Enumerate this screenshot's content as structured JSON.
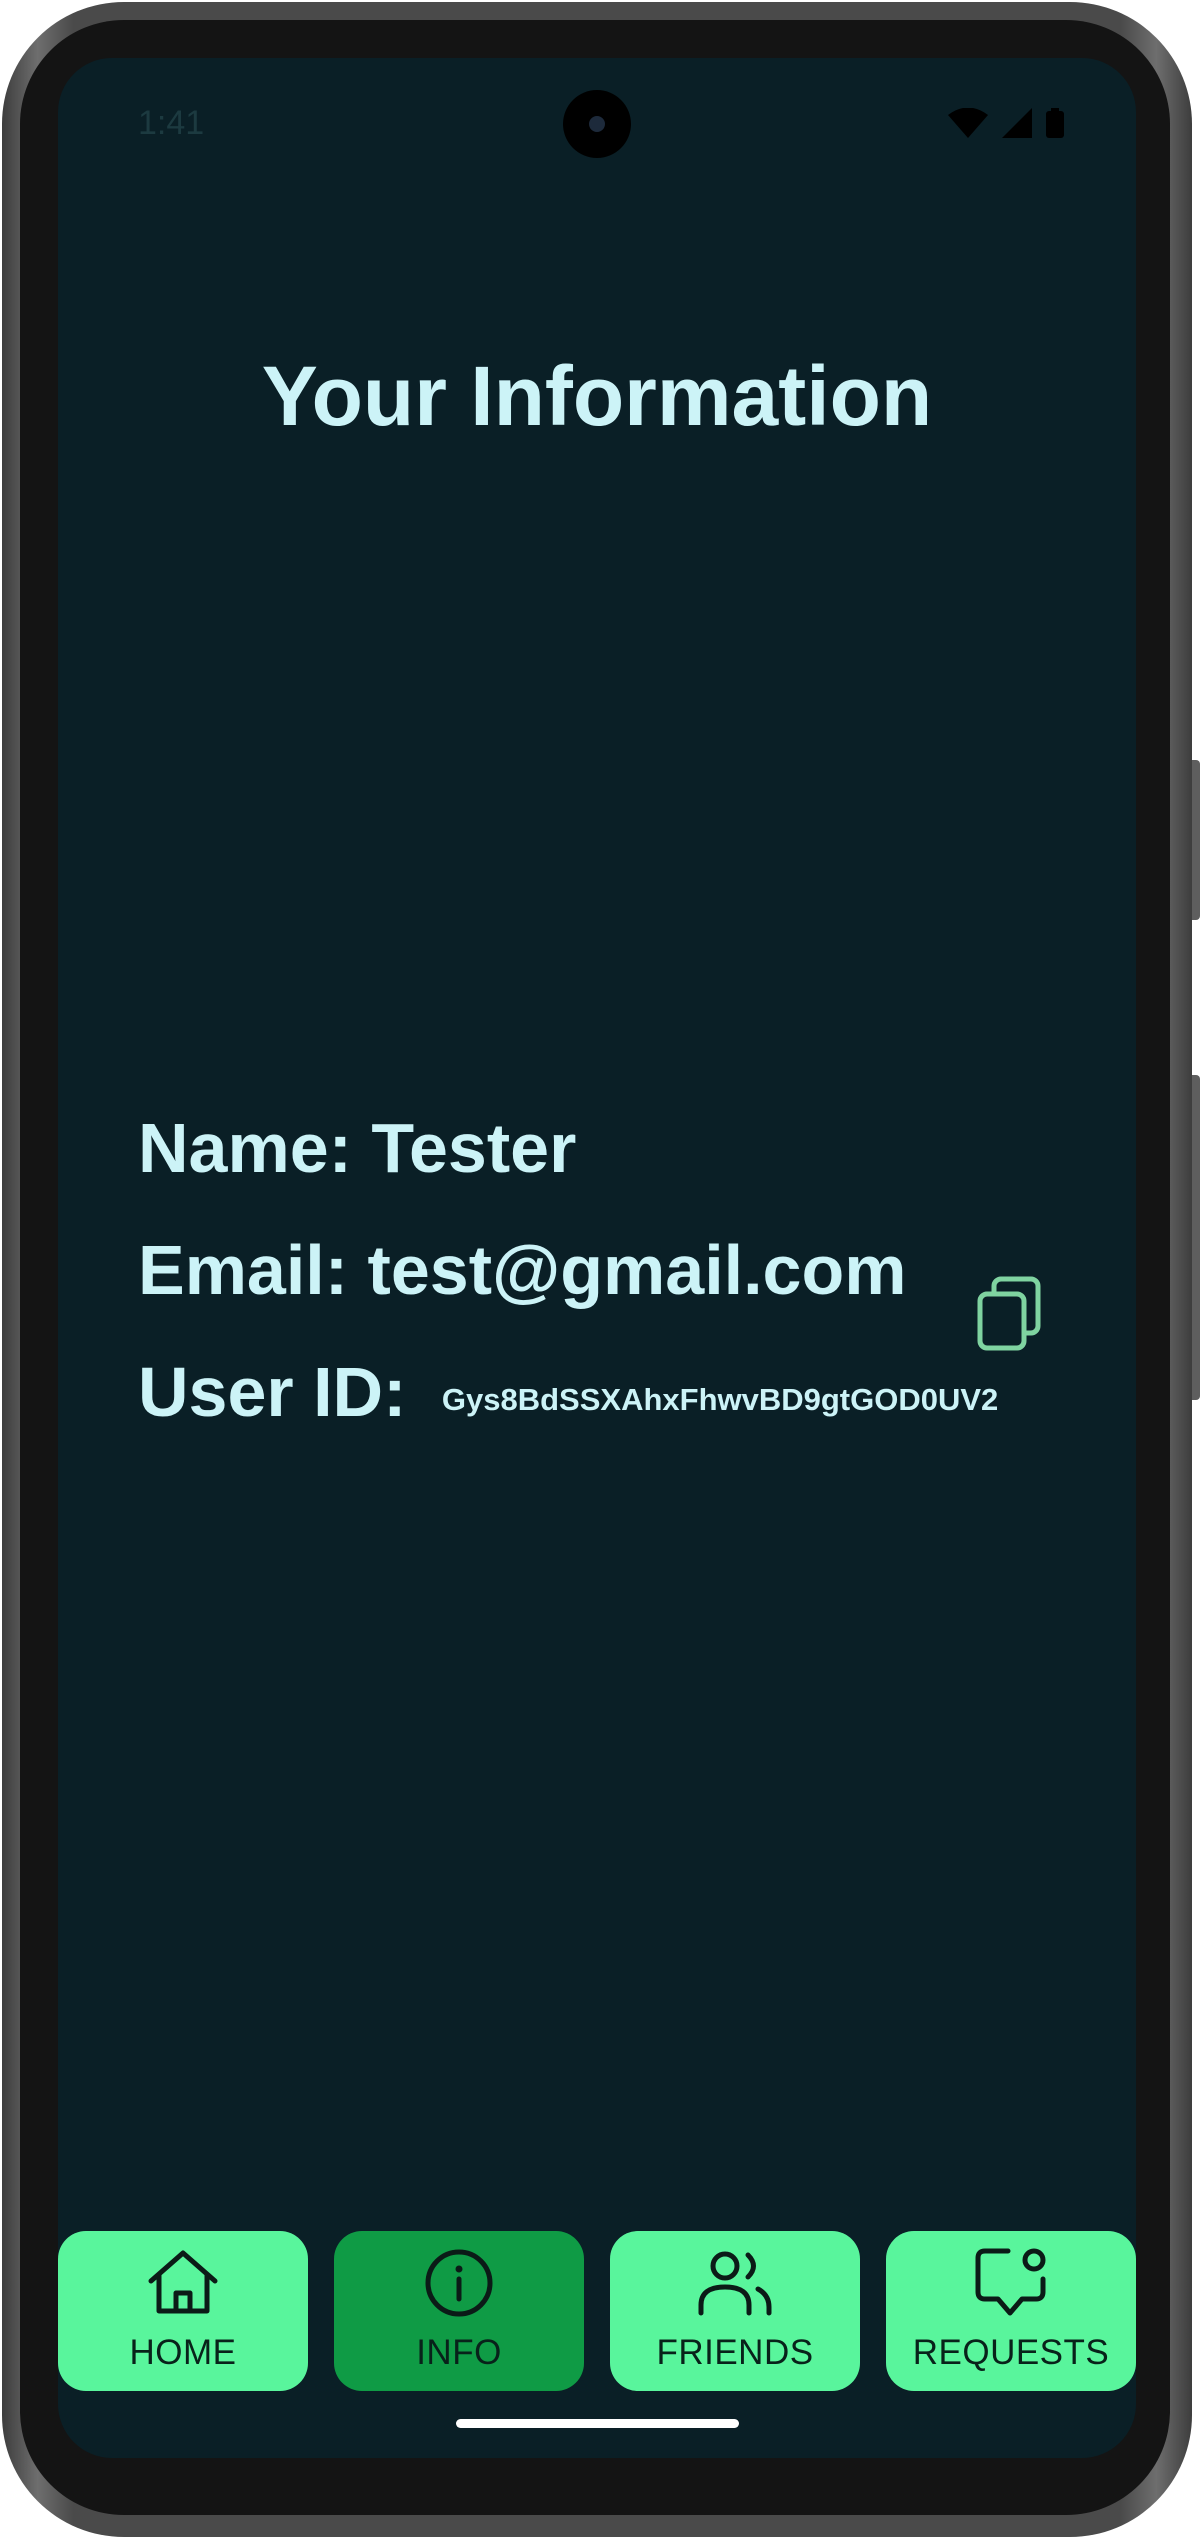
{
  "status_bar": {
    "time": "1:41"
  },
  "page": {
    "title": "Your Information"
  },
  "user": {
    "name_label": "Name:",
    "name": "Tester",
    "email_label": "Email:",
    "email": "test@gmail.com",
    "id_label": "User ID:",
    "id": "Gys8BdSSXAhxFhwvBD9gtGOD0UV2"
  },
  "nav": {
    "home": "HOME",
    "info": "INFO",
    "friends": "FRIENDS",
    "requests": "REQUESTS",
    "active": "info"
  },
  "colors": {
    "background": "#0a1f26",
    "text": "#ccf3f7",
    "nav_button": "#59f59c",
    "nav_active": "#0f9b45",
    "copy_icon": "#7fd3a0"
  },
  "icons": {
    "home": "home-icon",
    "info": "info-icon",
    "friends": "friends-icon",
    "requests": "requests-icon",
    "copy": "copy-icon"
  }
}
